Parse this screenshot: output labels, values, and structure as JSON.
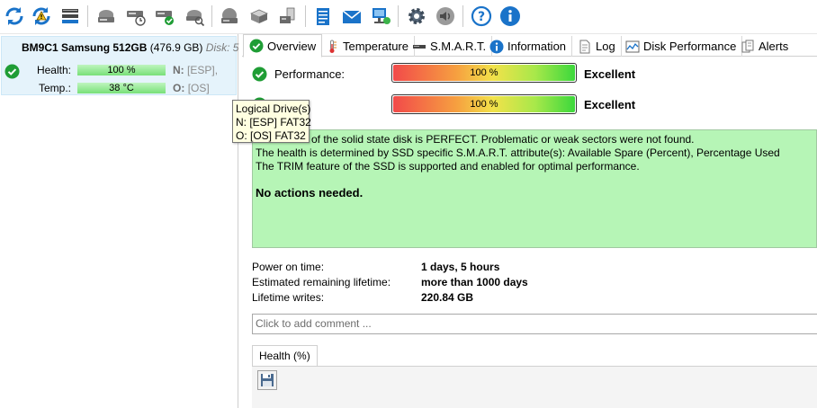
{
  "disk": {
    "name": "BM9C1 Samsung 512GB",
    "size": "(476.9 GB)",
    "disk_label": "Disk: 5",
    "health_label": "Health:",
    "health_value": "100 %",
    "health_fraction": 1.0,
    "temp_label": "Temp.:",
    "temp_value": "38 °C",
    "drive_n_letter": "N:",
    "drive_n_name": "[ESP],",
    "drive_o_letter": "O:",
    "drive_o_name": "[OS]"
  },
  "tabs": [
    {
      "label": "Overview",
      "icon": "check-icon",
      "active": true
    },
    {
      "label": "Temperature",
      "icon": "thermometer-icon"
    },
    {
      "label": "S.M.A.R.T.",
      "icon": "drive-icon"
    },
    {
      "label": "Information",
      "icon": "info-icon"
    },
    {
      "label": "Log",
      "icon": "document-icon"
    },
    {
      "label": "Disk Performance",
      "icon": "chart-icon"
    },
    {
      "label": "Alerts",
      "icon": "alerts-icon"
    }
  ],
  "overview": {
    "performance_label": "Performance:",
    "performance_value": "100 %",
    "performance_fraction": 1.0,
    "performance_rating": "Excellent",
    "health_value": "100 %",
    "health_fraction": 1.0,
    "health_rating": "Excellent",
    "status_lines": [
      "of the solid state disk is PERFECT. Problematic or weak sectors were not found.",
      "The health is determined by SSD specific S.M.A.R.T. attribute(s):  Available Spare (Percent), Percentage Used",
      "The TRIM feature of the SSD is supported and enabled for optimal performance."
    ],
    "action": "No actions needed.",
    "power_on_label": "Power on time:",
    "power_on_value": "1 days, 5 hours",
    "remaining_label": "Estimated remaining lifetime:",
    "remaining_value": "more than 1000 days",
    "writes_label": "Lifetime writes:",
    "writes_value": "220.84 GB",
    "comment_placeholder": "Click to add comment ...",
    "chart_tab": "Health (%)"
  },
  "tooltip": {
    "title": "Logical Drive(s)",
    "line1": "N: [ESP] FAT32",
    "line2": "O: [OS] FAT32"
  },
  "toolbar_icons": [
    "refresh-icon",
    "refresh-warning-icon",
    "disk-settings-icon",
    "hdd-icon",
    "hdd-clock-icon",
    "hdd-check-icon",
    "hdd-search-icon",
    "hdd-gray-icon",
    "hdd-usb-icon",
    "hdd-remove-icon",
    "notes-icon",
    "mail-icon",
    "network-icon",
    "gear-icon",
    "speaker-icon",
    "help-icon",
    "info-icon"
  ],
  "colors": {
    "ok_green": "#1f9d35",
    "health_box": "#b6f5b6",
    "selection": "#e5f3fb",
    "accent_blue": "#1a73c9"
  }
}
